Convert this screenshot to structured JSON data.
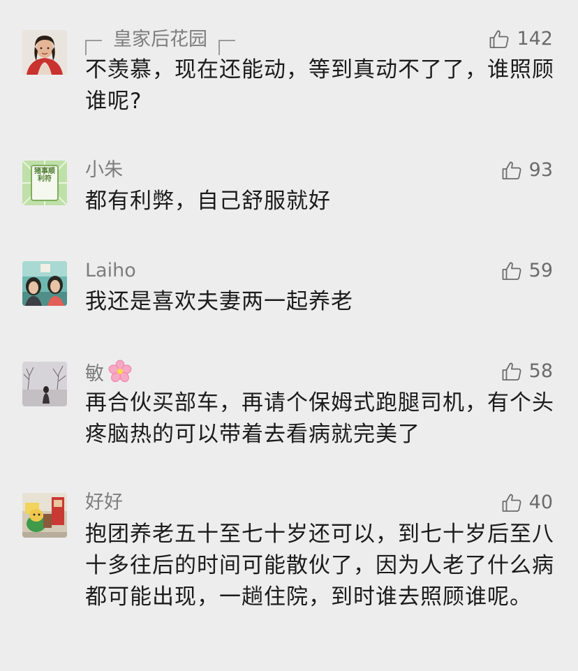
{
  "comments": [
    {
      "author": "皇家后花园",
      "likes": "142",
      "text": "不羡慕，现在还能动，等到真动不了了，谁照顾谁呢?",
      "avatar_icon": "portrait-avatar-woman"
    },
    {
      "author": "小朱",
      "likes": "93",
      "text": "都有利弊，自己舒服就好",
      "avatar_icon": "green-sign-avatar",
      "avatar_text": "猪事顺利符"
    },
    {
      "author": "Laiho",
      "likes": "59",
      "text": "我还是喜欢夫妻两一起养老",
      "avatar_icon": "couple-photo-avatar"
    },
    {
      "author": "敏",
      "author_emoji": "cherry-blossom-icon",
      "likes": "58",
      "text": "再合伙买部车，再请个保姆式跑腿司机，有个头疼脑热的可以带着去看病就完美了",
      "avatar_icon": "winter-scene-avatar"
    },
    {
      "author": "好好",
      "likes": "40",
      "text": "抱团养老五十至七十岁还可以，到七十岁后至八十多往后的时间可能散伙了，因为人老了什么病都可能出现，一趟住院，到时谁去照顾谁呢。",
      "avatar_icon": "toy-avatar"
    }
  ],
  "colors": {
    "background": "#ededed",
    "name": "#7d7d7d",
    "text": "#1b1b1b",
    "like": "#6b6b6b"
  }
}
